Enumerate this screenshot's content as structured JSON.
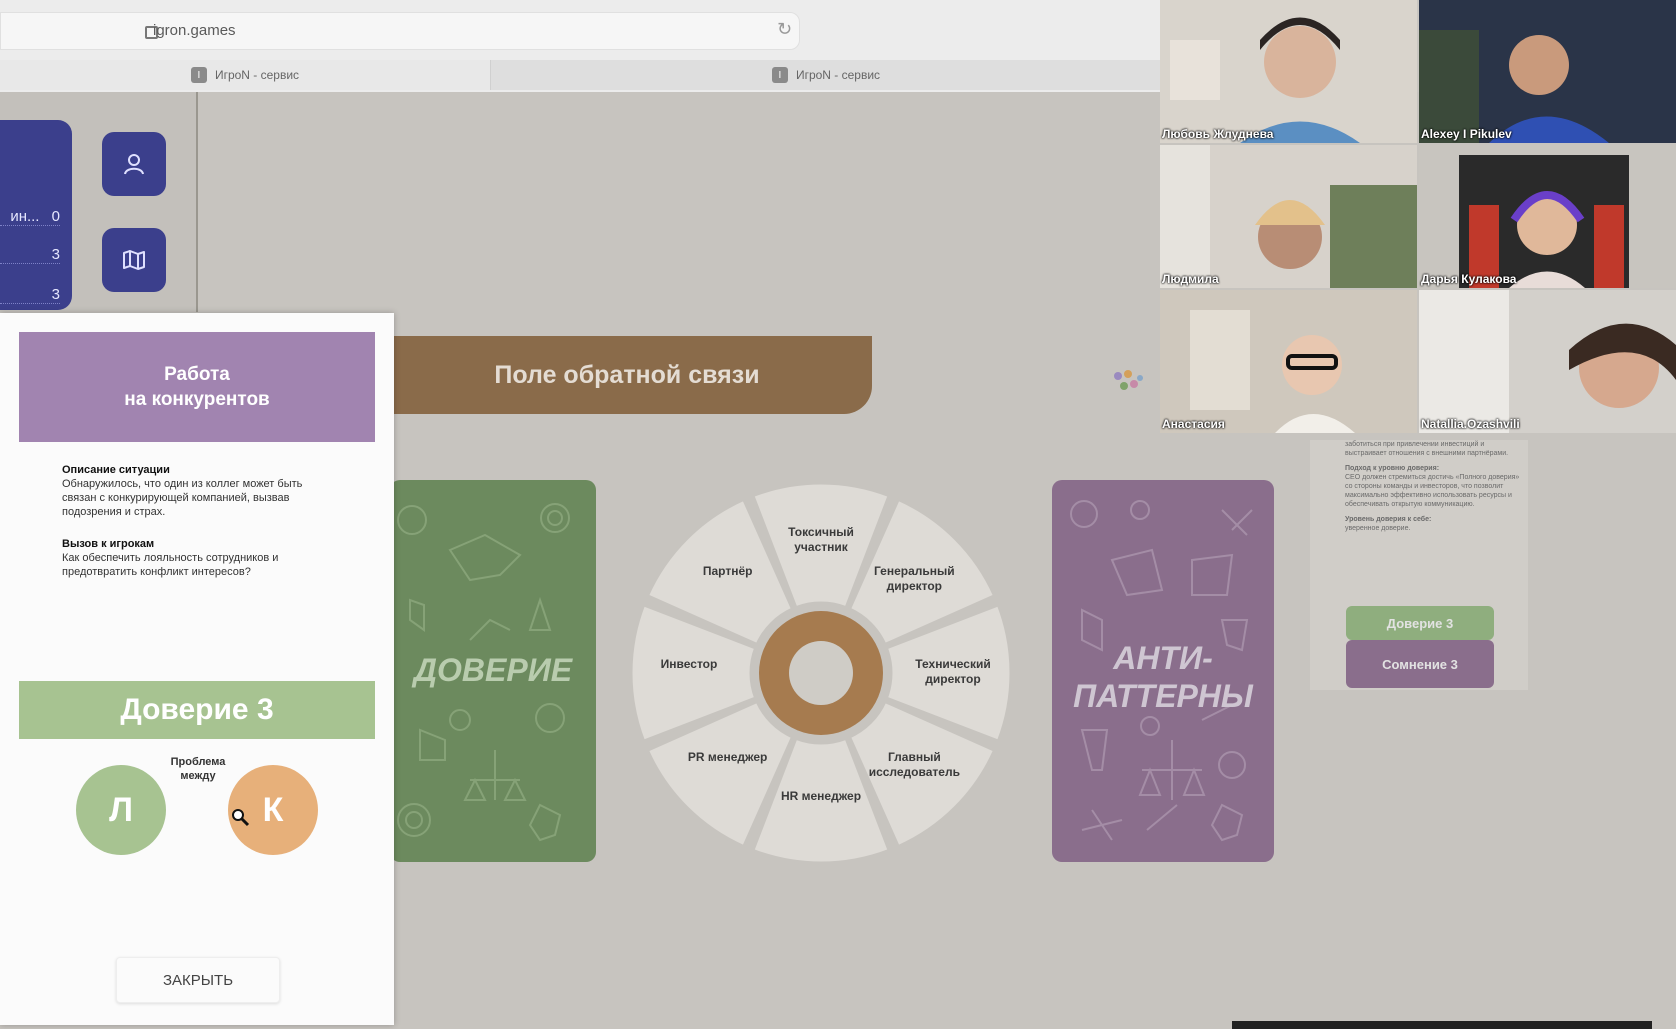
{
  "browser": {
    "url": "igron.games",
    "tabs": [
      {
        "label": "ИгроN - сервис"
      },
      {
        "label": "ИгроN - сервис"
      }
    ]
  },
  "sidebar": {
    "rows": [
      {
        "label": "ин...",
        "value": "0"
      },
      {
        "label": "",
        "value": "3"
      },
      {
        "label": "",
        "value": "3"
      }
    ],
    "buttons": [
      {
        "icon": "user-icon"
      },
      {
        "icon": "map-icon"
      }
    ]
  },
  "board": {
    "title": "Поле обратной связи",
    "trust_card": "ДОВЕРИЕ",
    "anti_card_line1": "АНТИ-",
    "anti_card_line2": "ПАТТЕРНЫ",
    "wheel": [
      "Токсичный участник",
      "Генеральный директор",
      "Технический директор",
      "Главный исследователь",
      "HR менеджер",
      "PR менеджер",
      "Инвестор",
      "Партнёр"
    ]
  },
  "side_doc": {
    "text1": "заботиться при привлечении инвестиций и выстраивает отношения с внешними партнёрами.",
    "heading2": "Подход к уровню доверия:",
    "text2": "CEO должен стремиться достичь «Полного доверия» со стороны команды и инвесторов, что позволит максимально эффективно использовать ресурсы и обеспечивать открытую коммуникацию.",
    "heading3": "Уровень доверия к себе:",
    "text3": "уверенное доверие.",
    "trust_button": "Доверие 3",
    "doubt_button": "Сомнение 3"
  },
  "popup": {
    "title_line1": "Работа",
    "title_line2": "на конкурентов",
    "situation_heading": "Описание ситуации",
    "situation_text": "Обнаружилось, что один из коллег может быть связан с конкурирующей компанией, вызвав подозрения и страх.",
    "challenge_heading": "Вызов к игрокам",
    "challenge_text": "Как обеспечить лояльность сотрудников и предотвратить конфликт интересов?",
    "trust_label": "Доверие 3",
    "problem_label_line1": "Проблема",
    "problem_label_line2": "между",
    "player1": "Л",
    "player2": "К",
    "close_button": "ЗАКРЫТЬ"
  },
  "participants": [
    {
      "name": "Любовь Жлуднева"
    },
    {
      "name": "Alexey I Pikulev"
    },
    {
      "name": "Людмила"
    },
    {
      "name": "Дарья Кулакова"
    },
    {
      "name": "Анастасия"
    },
    {
      "name": "Natallia.Ozashvili"
    }
  ],
  "colors": {
    "trust_green": "#6c8a5e",
    "anti_purple": "#8a6e8c",
    "banner_brown": "#8a6b4a",
    "sidebar_blue": "#3b3f8c",
    "player_l": "#a7c391",
    "player_k": "#e7b07a"
  }
}
